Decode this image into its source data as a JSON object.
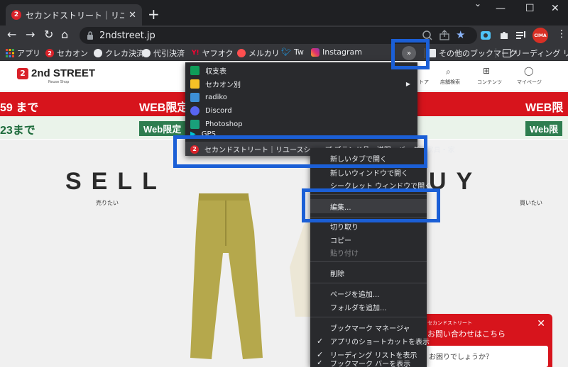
{
  "browser": {
    "tab_title": "セカンドストリート｜リユースショップ ブ",
    "tab_favicon": "2",
    "url": "2ndstreet.jp"
  },
  "window_controls": {
    "minimize": "—",
    "maximize": "☐",
    "close": "✕"
  },
  "bookmarks": [
    {
      "label": "アプリ",
      "icon": "apps-grid-icon"
    },
    {
      "label": "セカオン",
      "icon": "2nd-street-icon"
    },
    {
      "label": "クレカ決済",
      "icon": "globe-icon"
    },
    {
      "label": "代引決済",
      "icon": "globe-icon"
    },
    {
      "label": "ヤフオク",
      "icon": "yahoo-auction-icon"
    },
    {
      "label": "メルカリ",
      "icon": "mercari-icon"
    },
    {
      "label": "Tw",
      "icon": "twitter-icon"
    },
    {
      "label": "Instagram",
      "icon": "instagram-icon"
    }
  ],
  "other_bookmarks": "その他のブックマーク",
  "reading_list": "リーディング リスト",
  "profile_label": "CIMA",
  "site": {
    "logo_badge": "2",
    "logo_text": "2nd STREET",
    "logo_sub": "Reuse Shop",
    "nav": [
      "トア",
      "店舗検索",
      "コンテンツ",
      "マイページ"
    ],
    "banner1_left": "59 まで",
    "banner1_mid": "WEB限定 C",
    "banner1_right": "WEB限定",
    "banner2_left": "23まで",
    "banner2_mid": "Web限定",
    "banner2_right": "Web限",
    "sell": "SELL",
    "sell_sub": "売りたい",
    "buy": "UY",
    "buy_sub": "買いたい"
  },
  "chat": {
    "small": "セカンドストリート",
    "title": "お問い合わせはこちら",
    "input": "お困りでしょうか？"
  },
  "bookmark_menu": [
    {
      "label": "収支表",
      "icon": "sheets-icon"
    },
    {
      "label": "セカオン別",
      "icon": "folder-icon",
      "submenu": true
    },
    {
      "label": "radiko",
      "icon": "radiko-icon"
    },
    {
      "label": "Discord",
      "icon": "discord-icon"
    },
    {
      "label": "Photoshop",
      "icon": "photoshop-icon"
    },
    {
      "label": "GPS",
      "icon": "play-icon"
    },
    {
      "label": "セカンドストリート｜リユースショップ ブランド品・洋服・バッグ・家具・家",
      "icon": "2nd-street-icon"
    }
  ],
  "context_menu": {
    "open_new_tab": "新しいタブで開く",
    "open_new_window": "新しいウィンドウで開く",
    "open_incognito": "シークレット ウィンドウで開く",
    "edit": "編集...",
    "cut": "切り取り",
    "copy": "コピー",
    "paste": "貼り付け",
    "delete": "削除",
    "add_page": "ページを追加...",
    "add_folder": "フォルダを追加...",
    "bookmark_manager": "ブックマーク マネージャ",
    "show_apps": "アプリのショートカットを表示",
    "show_reading_list": "リーディング リストを表示",
    "show_bookmark_bar": "ブックマーク バーを表示"
  },
  "colors": {
    "brand_red": "#d7141c",
    "annotation_blue": "#1b5fd6",
    "menu_bg": "#292a2d",
    "chrome_toolbar": "#35363a"
  }
}
